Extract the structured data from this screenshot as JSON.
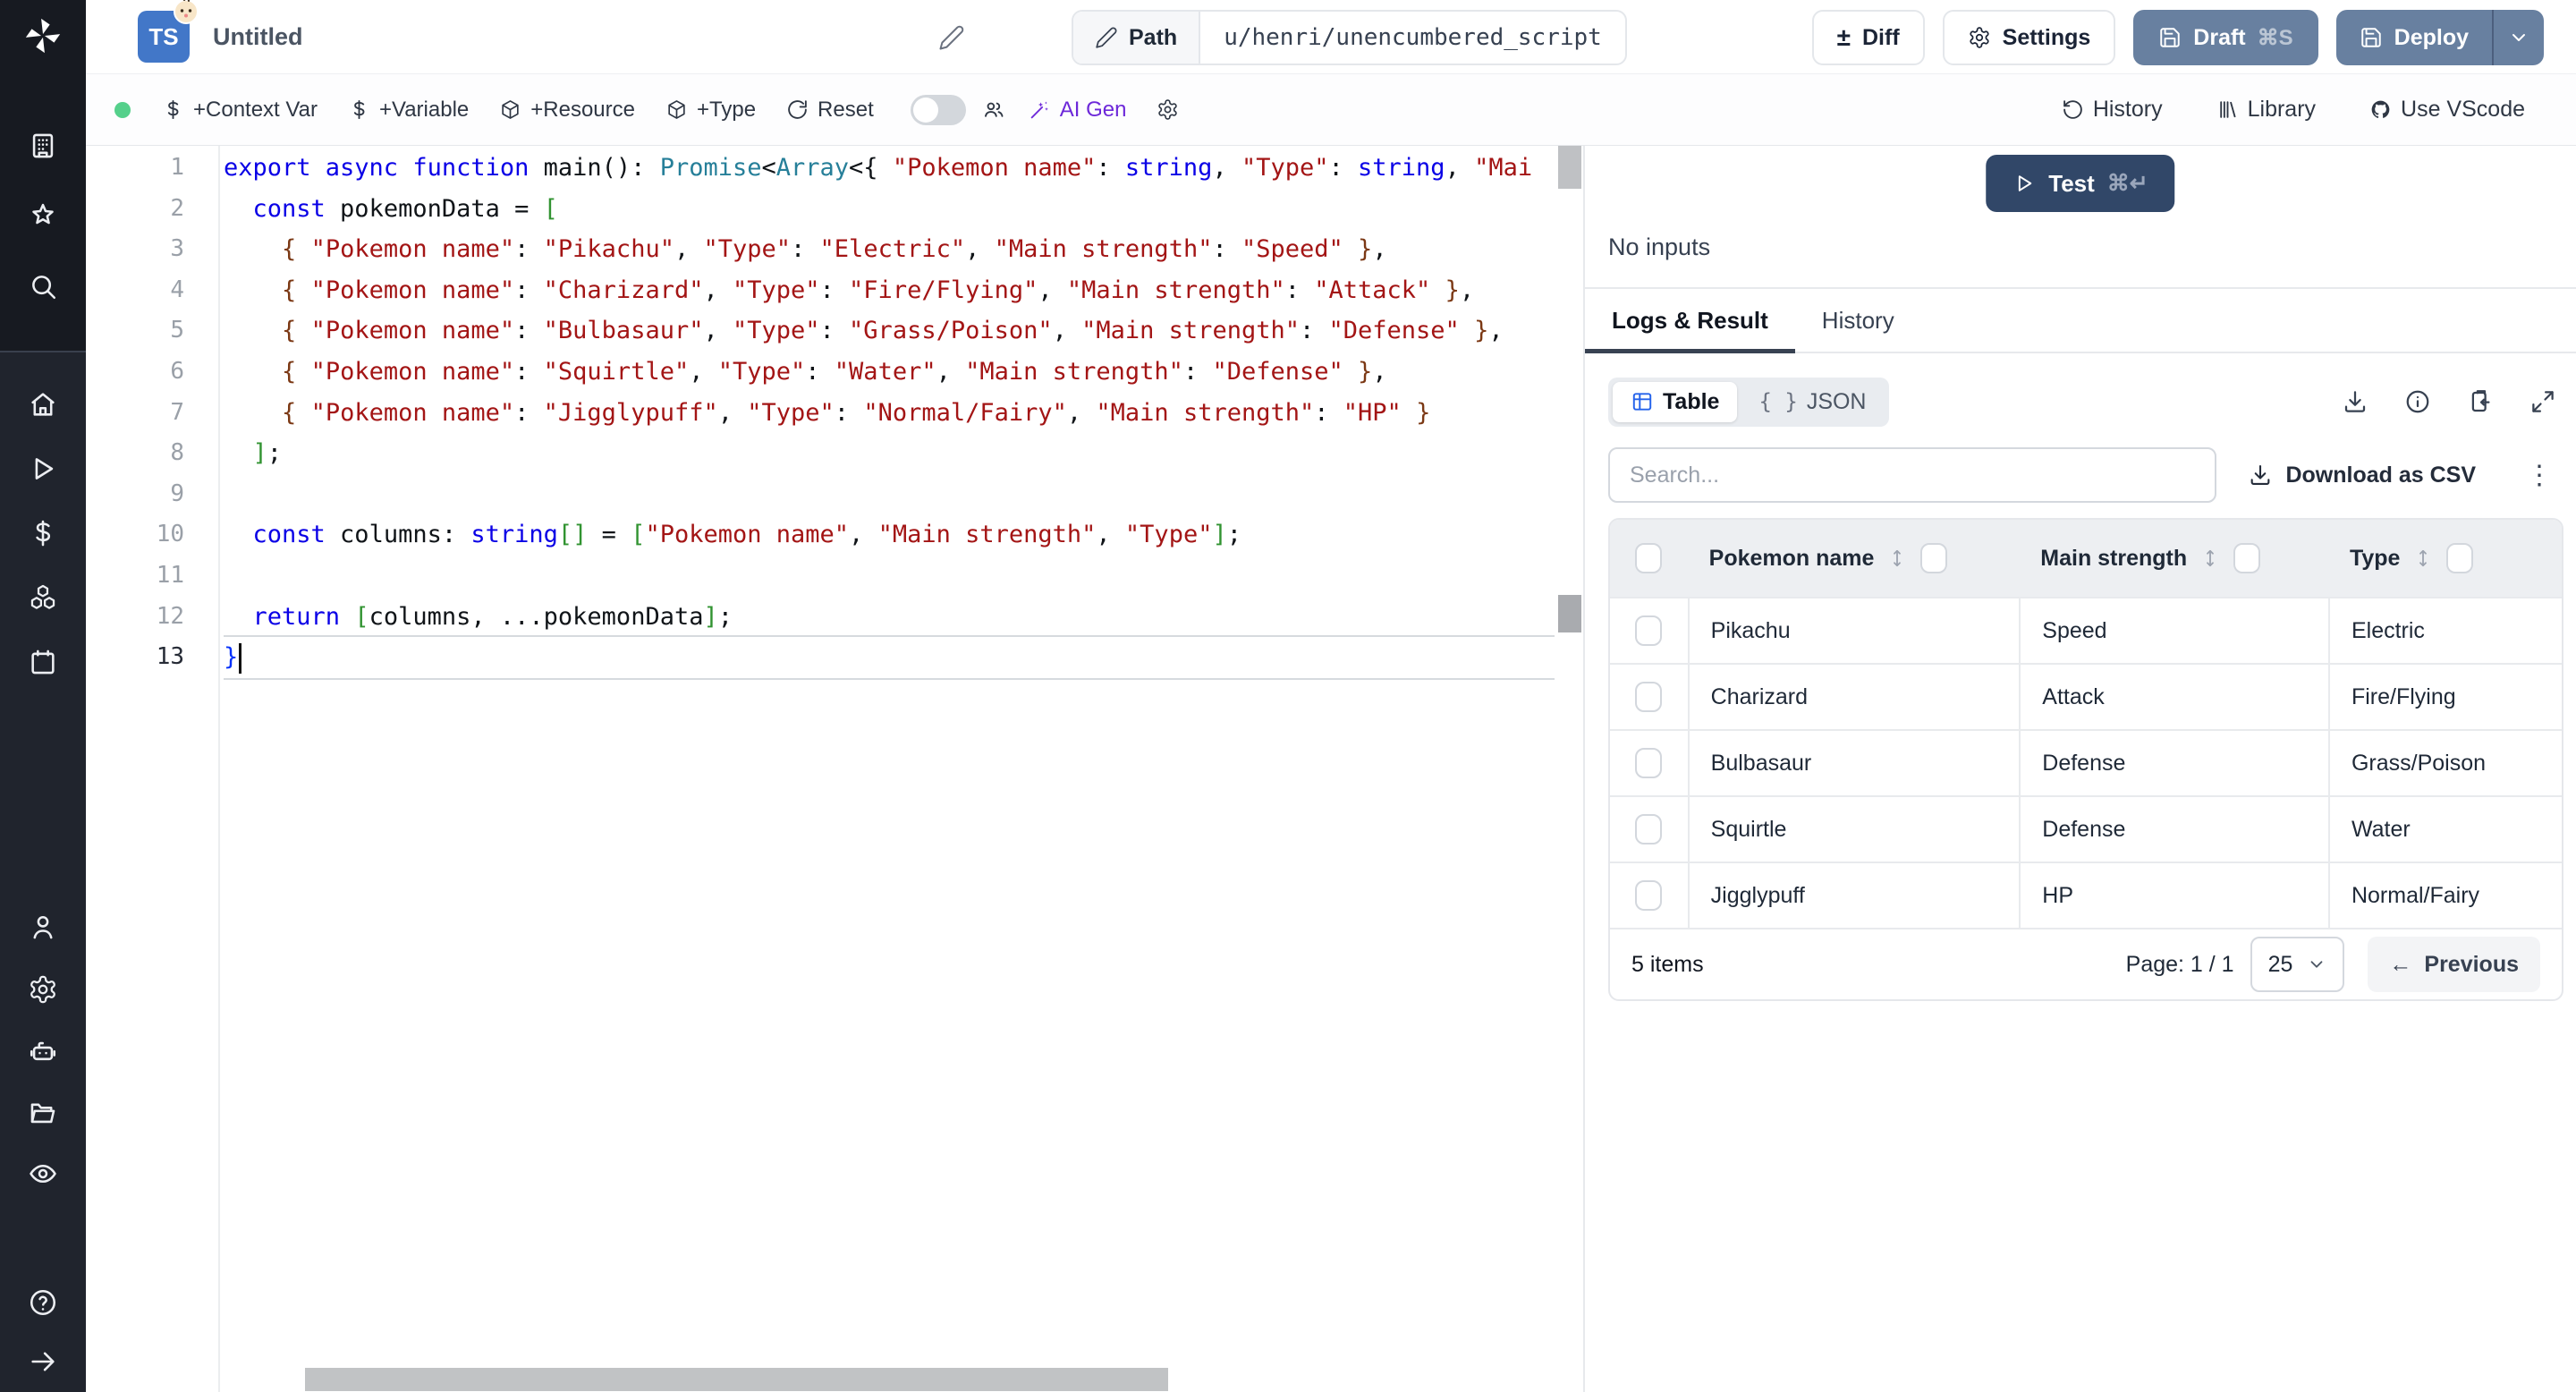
{
  "app": {
    "name": "windmill",
    "accent": "#6880a0",
    "test_color": "#314768",
    "ai_color": "#6d28d9",
    "ts_color": "#4277c8",
    "status_dot_color": "#55d08b"
  },
  "header": {
    "file_badge": "TS",
    "title": "Untitled",
    "path_label": "Path",
    "path_value": "u/henri/unencumbered_script",
    "diff": "Diff",
    "settings": "Settings",
    "draft": "Draft",
    "draft_kbd": "⌘S",
    "deploy": "Deploy"
  },
  "toolbar": {
    "context_var": "+Context Var",
    "variable": "+Variable",
    "resource": "+Resource",
    "type": "+Type",
    "reset": "Reset",
    "ai_gen": "AI Gen",
    "history": "History",
    "library": "Library",
    "vscode": "Use VScode"
  },
  "run": {
    "test": "Test",
    "test_kbd": "⌘↵",
    "no_inputs": "No inputs"
  },
  "tabs": {
    "logs": "Logs & Result",
    "history": "History"
  },
  "result": {
    "table_view": "Table",
    "json_view": "JSON",
    "json_braces": "{ }",
    "search_placeholder": "Search...",
    "download_csv": "Download as CSV",
    "kebab": "⋮"
  },
  "table": {
    "columns": [
      "Pokemon name",
      "Main strength",
      "Type"
    ],
    "rows": [
      [
        "Pikachu",
        "Speed",
        "Electric"
      ],
      [
        "Charizard",
        "Attack",
        "Fire/Flying"
      ],
      [
        "Bulbasaur",
        "Defense",
        "Grass/Poison"
      ],
      [
        "Squirtle",
        "Defense",
        "Water"
      ],
      [
        "Jigglypuff",
        "HP",
        "Normal/Fairy"
      ]
    ],
    "items_count": "5 items",
    "page_label": "Page: 1 / 1",
    "page_size": "25",
    "previous": "Previous",
    "previous_arrow": "←"
  },
  "editor": {
    "lines": [
      {
        "n": "1",
        "s": [
          [
            "kw",
            "export async function "
          ],
          [
            "pl",
            "main"
          ],
          [
            "pl",
            "(): "
          ],
          [
            "ty",
            "Promise"
          ],
          [
            "pl",
            "<"
          ],
          [
            "ty",
            "Array"
          ],
          [
            "pl",
            "<{ "
          ],
          [
            "st",
            "\"Pokemon name\""
          ],
          [
            "pl",
            ": "
          ],
          [
            "kw",
            "string"
          ],
          [
            "pl",
            ", "
          ],
          [
            "st",
            "\"Type\""
          ],
          [
            "pl",
            ": "
          ],
          [
            "kw",
            "string"
          ],
          [
            "pl",
            ", "
          ],
          [
            "st",
            "\"Mai"
          ]
        ]
      },
      {
        "n": "2",
        "s": [
          [
            "pl",
            "  "
          ],
          [
            "kw",
            "const"
          ],
          [
            "pl",
            " pokemonData = "
          ],
          [
            "b2",
            "["
          ]
        ]
      },
      {
        "n": "3",
        "s": [
          [
            "pl",
            "    "
          ],
          [
            "b3",
            "{"
          ],
          [
            "pl",
            " "
          ],
          [
            "st",
            "\"Pokemon name\""
          ],
          [
            "pl",
            ": "
          ],
          [
            "st",
            "\"Pikachu\""
          ],
          [
            "pl",
            ", "
          ],
          [
            "st",
            "\"Type\""
          ],
          [
            "pl",
            ": "
          ],
          [
            "st",
            "\"Electric\""
          ],
          [
            "pl",
            ", "
          ],
          [
            "st",
            "\"Main strength\""
          ],
          [
            "pl",
            ": "
          ],
          [
            "st",
            "\"Speed\""
          ],
          [
            "pl",
            " "
          ],
          [
            "b3",
            "}"
          ],
          [
            "pl",
            ","
          ]
        ]
      },
      {
        "n": "4",
        "s": [
          [
            "pl",
            "    "
          ],
          [
            "b3",
            "{"
          ],
          [
            "pl",
            " "
          ],
          [
            "st",
            "\"Pokemon name\""
          ],
          [
            "pl",
            ": "
          ],
          [
            "st",
            "\"Charizard\""
          ],
          [
            "pl",
            ", "
          ],
          [
            "st",
            "\"Type\""
          ],
          [
            "pl",
            ": "
          ],
          [
            "st",
            "\"Fire/Flying\""
          ],
          [
            "pl",
            ", "
          ],
          [
            "st",
            "\"Main strength\""
          ],
          [
            "pl",
            ": "
          ],
          [
            "st",
            "\"Attack\""
          ],
          [
            "pl",
            " "
          ],
          [
            "b3",
            "}"
          ],
          [
            "pl",
            ","
          ]
        ]
      },
      {
        "n": "5",
        "s": [
          [
            "pl",
            "    "
          ],
          [
            "b3",
            "{"
          ],
          [
            "pl",
            " "
          ],
          [
            "st",
            "\"Pokemon name\""
          ],
          [
            "pl",
            ": "
          ],
          [
            "st",
            "\"Bulbasaur\""
          ],
          [
            "pl",
            ", "
          ],
          [
            "st",
            "\"Type\""
          ],
          [
            "pl",
            ": "
          ],
          [
            "st",
            "\"Grass/Poison\""
          ],
          [
            "pl",
            ", "
          ],
          [
            "st",
            "\"Main strength\""
          ],
          [
            "pl",
            ": "
          ],
          [
            "st",
            "\"Defense\""
          ],
          [
            "pl",
            " "
          ],
          [
            "b3",
            "}"
          ],
          [
            "pl",
            ","
          ]
        ]
      },
      {
        "n": "6",
        "s": [
          [
            "pl",
            "    "
          ],
          [
            "b3",
            "{"
          ],
          [
            "pl",
            " "
          ],
          [
            "st",
            "\"Pokemon name\""
          ],
          [
            "pl",
            ": "
          ],
          [
            "st",
            "\"Squirtle\""
          ],
          [
            "pl",
            ", "
          ],
          [
            "st",
            "\"Type\""
          ],
          [
            "pl",
            ": "
          ],
          [
            "st",
            "\"Water\""
          ],
          [
            "pl",
            ", "
          ],
          [
            "st",
            "\"Main strength\""
          ],
          [
            "pl",
            ": "
          ],
          [
            "st",
            "\"Defense\""
          ],
          [
            "pl",
            " "
          ],
          [
            "b3",
            "}"
          ],
          [
            "pl",
            ","
          ]
        ]
      },
      {
        "n": "7",
        "s": [
          [
            "pl",
            "    "
          ],
          [
            "b3",
            "{"
          ],
          [
            "pl",
            " "
          ],
          [
            "st",
            "\"Pokemon name\""
          ],
          [
            "pl",
            ": "
          ],
          [
            "st",
            "\"Jigglypuff\""
          ],
          [
            "pl",
            ", "
          ],
          [
            "st",
            "\"Type\""
          ],
          [
            "pl",
            ": "
          ],
          [
            "st",
            "\"Normal/Fairy\""
          ],
          [
            "pl",
            ", "
          ],
          [
            "st",
            "\"Main strength\""
          ],
          [
            "pl",
            ": "
          ],
          [
            "st",
            "\"HP\""
          ],
          [
            "pl",
            " "
          ],
          [
            "b3",
            "}"
          ]
        ]
      },
      {
        "n": "8",
        "s": [
          [
            "pl",
            "  "
          ],
          [
            "b2",
            "]"
          ],
          [
            "pl",
            ";"
          ]
        ]
      },
      {
        "n": "9",
        "s": []
      },
      {
        "n": "10",
        "s": [
          [
            "pl",
            "  "
          ],
          [
            "kw",
            "const"
          ],
          [
            "pl",
            " columns: "
          ],
          [
            "kw",
            "string"
          ],
          [
            "b2",
            "[]"
          ],
          [
            "pl",
            " = "
          ],
          [
            "b2",
            "["
          ],
          [
            "st",
            "\"Pokemon name\""
          ],
          [
            "pl",
            ", "
          ],
          [
            "st",
            "\"Main strength\""
          ],
          [
            "pl",
            ", "
          ],
          [
            "st",
            "\"Type\""
          ],
          [
            "b2",
            "]"
          ],
          [
            "pl",
            ";"
          ]
        ]
      },
      {
        "n": "11",
        "s": []
      },
      {
        "n": "12",
        "s": [
          [
            "pl",
            "  "
          ],
          [
            "kw",
            "return"
          ],
          [
            "pl",
            " "
          ],
          [
            "b2",
            "["
          ],
          [
            "pl",
            "columns, ...pokemonData"
          ],
          [
            "b2",
            "]"
          ],
          [
            "pl",
            ";"
          ]
        ]
      },
      {
        "n": "13",
        "cur": true,
        "s": [
          [
            "b1",
            "}"
          ]
        ]
      }
    ]
  }
}
